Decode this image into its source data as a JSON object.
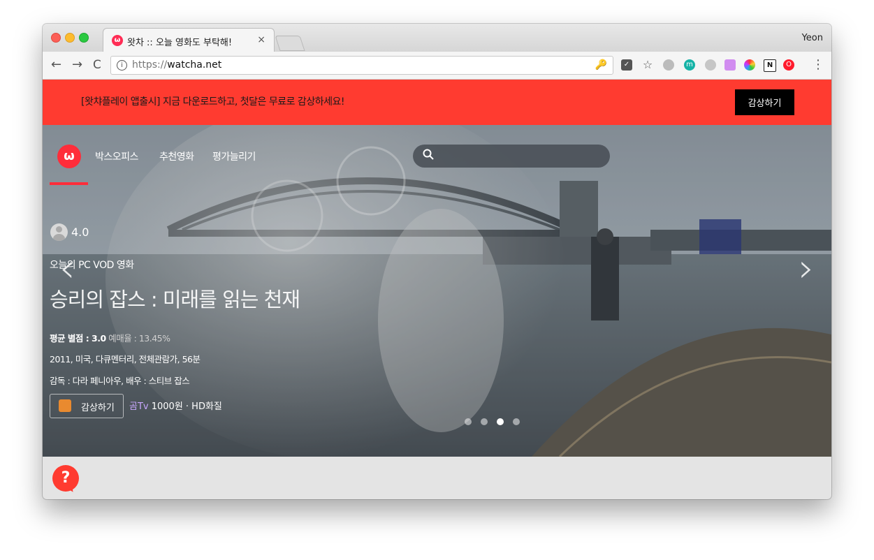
{
  "browser": {
    "tab_title": "왓차 :: 오늘 영화도 부탁해!",
    "tab_close": "×",
    "profile_name": "Yeon",
    "url_prefix": "https://",
    "url_domain": "watcha.net",
    "nav": {
      "back": "←",
      "forward": "→",
      "reload": "C",
      "menu": "⋮"
    },
    "extensions": [
      "key-icon",
      "pocket-icon",
      "star-icon",
      "globe-icon",
      "m-extension-icon",
      "gray-extension-icon",
      "puzzle-extension-icon",
      "color-wheel-icon",
      "notion-icon",
      "opera-icon"
    ]
  },
  "promo": {
    "text": "[왓챠플레이 앱출시] 지금 다운로드하고, 첫달은 무료로 감상하세요!",
    "button": "감상하기"
  },
  "site": {
    "logo": "ω",
    "nav_items": [
      "박스오피스",
      "추천영화",
      "평가늘리기"
    ],
    "search_placeholder": ""
  },
  "hero": {
    "rating": "4.0",
    "subtitle": "오늘의 PC VOD 영화",
    "title": "승리의 잡스 : 미래를 읽는 천재",
    "line1_bold": "평균 별점 : 3.0",
    "line1_dim": "예매율 : 13.45%",
    "line2": "2011, 미국, 다큐멘터리, 전체관람가, 56분",
    "line3": "감독 : 다라 페니아우, 배우 : 스티브 잡스",
    "watch_button": "감상하기",
    "provider_name": "곰Tv",
    "provider_detail": " 1000원 · HD화질",
    "prev_arrow": "‹",
    "next_arrow": "›",
    "slides": {
      "count": 4,
      "active_index": 2
    }
  },
  "help": {
    "label": "?"
  },
  "colors": {
    "accent": "#ff3b30",
    "brand": "#ff2d3a"
  }
}
